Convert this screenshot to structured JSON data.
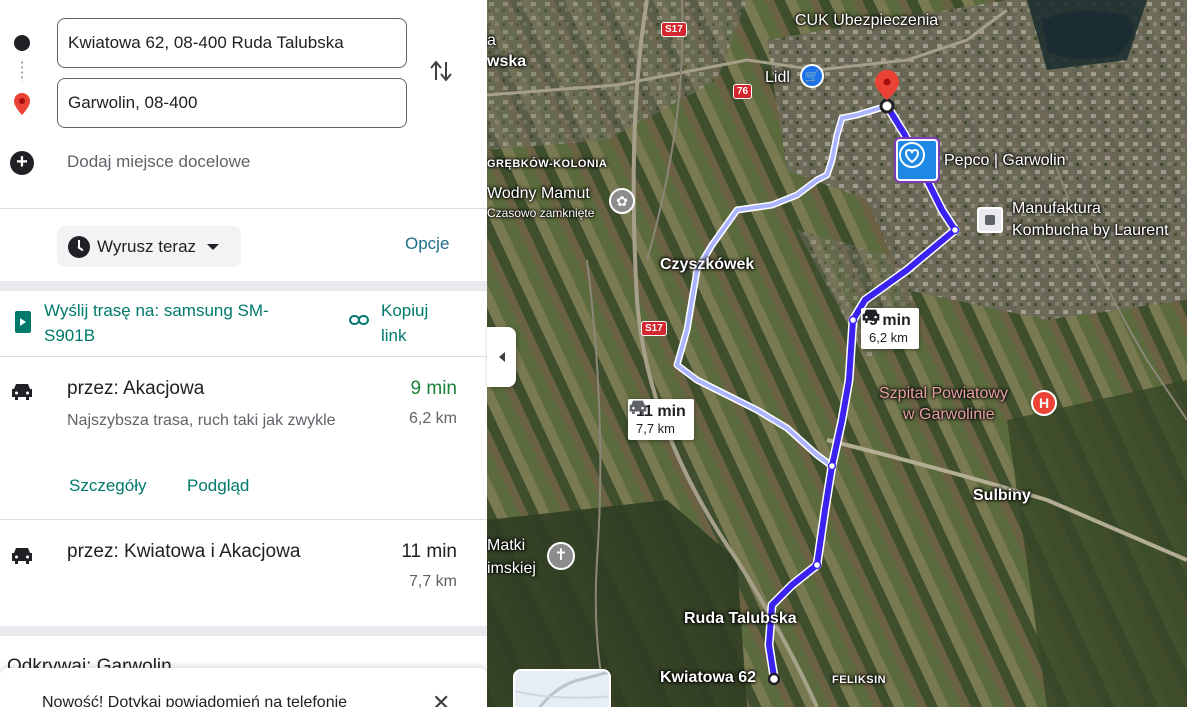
{
  "directions": {
    "cutoff_text": "",
    "origin_value": "Kwiatowa 62, 08-400 Ruda Talubska",
    "destination_value": "Garwolin, 08-400",
    "add_destination_label": "Dodaj miejsce docelowe",
    "depart_label": "Wyrusz teraz",
    "options_label": "Opcje",
    "send_label": "Wyślij trasę na: samsung SM-S901B",
    "copy_link_label": "Kopiuj link"
  },
  "routes": [
    {
      "title": "przez: Akacjowa",
      "time": "9 min",
      "distance": "6,2 km",
      "description": "Najszybsza trasa, ruch taki jak zwykle",
      "details_label": "Szczegóły",
      "preview_label": "Podgląd"
    },
    {
      "title": "przez: Kwiatowa i Akacjowa",
      "time": "11 min",
      "distance": "7,7 km"
    }
  ],
  "explore_label": "Odkrywaj: Garwolin",
  "toast": {
    "text": "Nowość! Dotykaj powiadomień na telefonie"
  },
  "map": {
    "labels": {
      "cuk": "CUK Ubezpieczenia",
      "lidl": "Lidl",
      "pepco": "Pepco | Garwolin",
      "manufaktura_1": "Manufaktura",
      "manufaktura_2": "Kombucha by Laurent",
      "wodny_mamut": "Wodny Mamut",
      "czasowo": "Czasowo zamknięte",
      "grebkow": "GRĘBKÓW-KOLONIA",
      "czyszkowek": "Czyszkówek",
      "szpital_1": "Szpital Powiatowy",
      "szpital_2": "w Garwolinie",
      "sulbiny": "Sulbiny",
      "matki_1": "Matki",
      "matki_2": "imskiej",
      "ruda": "Ruda Talubska",
      "kwiatowa": "Kwiatowa 62",
      "feliksin": "FELIKSIN",
      "left_edge_1": "a",
      "left_edge_2": "wska"
    },
    "road_badges": [
      "S17",
      "76",
      "S17"
    ],
    "route_bubbles": [
      {
        "time": "9 min",
        "distance": "6,2 km"
      },
      {
        "time": "11 min",
        "distance": "7,7 km"
      }
    ],
    "colors": {
      "primary_route": "#3a22f0",
      "alt_route": "#aab4ff",
      "pin": "#ea4335"
    }
  }
}
